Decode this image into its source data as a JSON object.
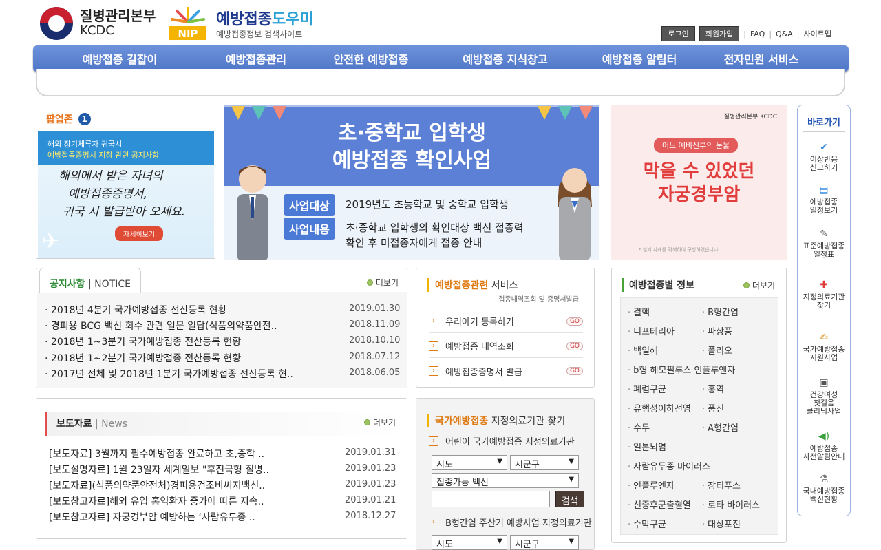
{
  "header": {
    "org_name_ko": "질병관리본부",
    "org_name_en": "KCDC",
    "site_title_a": "예방접종",
    "site_title_b": "도우미",
    "site_subtitle": "예방접종정보 검색사이트",
    "nip_label": "NIP"
  },
  "util_nav": {
    "login": "로그인",
    "join": "회원가입",
    "faq": "FAQ",
    "qa": "Q&A",
    "sitemap": "사이트맵"
  },
  "gnb": [
    "예방접종 길잡이",
    "예방접종관리",
    "안전한 예방접종",
    "예방접종 지식창고",
    "예방접종 알림터",
    "전자민원 서비스"
  ],
  "popup": {
    "title": "팝업존",
    "count": "1",
    "line1": "해외 장기체류자 귀국시",
    "line2": "예방접종증명서 지참 관련 공지사항",
    "hand1": "해외에서 받은 자녀의",
    "hand2": "예방접종증명서,",
    "hand3": "귀국 시 발급받아 오세요.",
    "more": "자세히보기"
  },
  "main_banner": {
    "title1": "초·중학교 입학생",
    "title2": "예방접종 확인사업",
    "tag1": "사업대상",
    "text1": "2019년도 초등학교 및 중학교 입학생",
    "tag2": "사업내용",
    "text2a": "초·중학교 입학생의 확인대상 백신 접종력",
    "text2b": "확인 후 미접종자에게 접종 안내"
  },
  "right_banner": {
    "kcdc": "질병관리본부 KCDC",
    "pill": "어느 예비신부의 눈물",
    "title1": "막을 수 있었던",
    "title2": "자궁경부암",
    "foot": "* 실제 사례를 각색하여 구성하였습니다."
  },
  "quick": {
    "title": "바로가기",
    "items": [
      {
        "l1": "이상반응",
        "l2": "신고하기",
        "icon": "check-icon"
      },
      {
        "l1": "예방접종",
        "l2": "일정보기",
        "icon": "calendar-icon"
      },
      {
        "l1": "표준예방접종",
        "l2": "일정표",
        "icon": "syringe-icon"
      },
      {
        "l1": "지정의료기관",
        "l2": "찾기",
        "icon": "hospital-icon"
      },
      {
        "l1": "국가예방접종",
        "l2": "지원사업",
        "icon": "document-icon"
      },
      {
        "l1": "건강여성",
        "l2": "첫걸음",
        "l3": "클리닉사업",
        "icon": "box-icon"
      },
      {
        "l1": "예방접종",
        "l2": "사전알림안내",
        "icon": "speaker-icon"
      },
      {
        "l1": "국내예방접종",
        "l2": "백신현황",
        "icon": "vial-icon"
      }
    ]
  },
  "notice": {
    "title": "공지사항",
    "title_en": "NOTICE",
    "more": "더보기",
    "items": [
      {
        "text": "2018년 4분기 국가예방접종 전산등록 현황",
        "date": "2019.01.30"
      },
      {
        "text": "경피용 BCG 백신 회수 관련 일문 일답(식품의약품안전..",
        "date": "2018.11.09"
      },
      {
        "text": "2018년 1~3분기 국가예방접종 전산등록 현황",
        "date": "2018.10.10"
      },
      {
        "text": "2018년 1~2분기 국가예방접종 전산등록 현황",
        "date": "2018.07.12"
      },
      {
        "text": "2017년 전체 및 2018년 1분기 국가예방접종 전산등록 현..",
        "date": "2018.06.05"
      }
    ]
  },
  "press": {
    "title": "보도자료",
    "title_en": "News",
    "more": "더보기",
    "items": [
      {
        "text": "[보도자료] 3월까지 필수예방접종 완료하고 초,중학 ..",
        "date": "2019.01.31"
      },
      {
        "text": "[보도설명자료] 1월 23일자 세계일보 \"후진국형 질병..",
        "date": "2019.01.23"
      },
      {
        "text": "[보도자료](식품의약품안전처)경피용건조비씨지백신..",
        "date": "2019.01.23"
      },
      {
        "text": "[보도참고자료]해외 유입 홍역환자 증가에 따른 지속..",
        "date": "2019.01.21"
      },
      {
        "text": "[보도참고자료] 자궁경부암 예방하는 ‘사람유두종 ..",
        "date": "2018.12.27"
      }
    ]
  },
  "service": {
    "title_a": "예방접종관련",
    "title_b": " 서비스",
    "sub": "접종내역조회 및 증명서발급",
    "go": "GO",
    "items": [
      "우리아기 등록하기",
      "예방접종 내역조회",
      "예방접종증명서 발급"
    ]
  },
  "clinic": {
    "title_a": "국가예방접종",
    "title_b": " 지정의료기관 찾기",
    "sub1": "어린이 국가예방접종 지정의료기관",
    "sido": "시도",
    "sigungu": "시군구",
    "vaccine": "접종가능 백신",
    "search": "검색",
    "sub2": "B형간염 주산기 예방사업 지정의료기관",
    "sido2": "시도",
    "sigungu2": "시군구"
  },
  "vaccines": {
    "title": "예방접종별 정보",
    "more": "더보기",
    "left": [
      "결핵",
      "디프테리아",
      "백일해",
      "b형 헤모필루스 인플루엔자",
      "폐렴구균",
      "유행성이하선염",
      "수두",
      "일본뇌염",
      "사람유두종 바이러스",
      "인플루엔자",
      "신증후군출혈열",
      "수막구균"
    ],
    "right": [
      "B형간염",
      "파상풍",
      "폴리오",
      "",
      "홍역",
      "풍진",
      "A형간염",
      "",
      "",
      "장티푸스",
      "로타 바이러스",
      "대상포진"
    ]
  }
}
